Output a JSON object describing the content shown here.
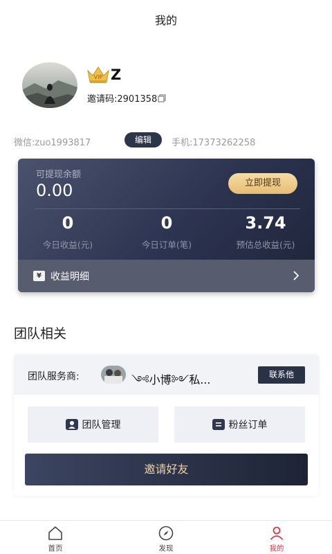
{
  "header": {
    "title": "我的"
  },
  "profile": {
    "nickname": "Z",
    "invite_code": "邀请码:2901358",
    "wechat": "微信:zuo1993817",
    "edit_label": "编辑",
    "phone": "手机:17373262258",
    "vip_badge": "VIP"
  },
  "earnings": {
    "balance_label": "可提现余额",
    "balance_value": "0.00",
    "withdraw_label": "立即提现",
    "stats": [
      {
        "value": "0",
        "label": "今日收益(元)"
      },
      {
        "value": "0",
        "label": "今日订单(笔)"
      },
      {
        "value": "3.74",
        "label": "预估总收益(元)"
      }
    ],
    "detail_label": "收益明细",
    "detail_icon": "¥"
  },
  "team": {
    "section_title": "团队相关",
    "provider_label": "团队服务商:",
    "provider_name": "༺小博༻私...",
    "contact_label": "联系他",
    "tiles": [
      {
        "label": "团队管理",
        "icon": "team-icon"
      },
      {
        "label": "粉丝订单",
        "icon": "list-icon"
      }
    ],
    "invite_label": "邀请好友"
  },
  "tabbar": {
    "items": [
      {
        "label": "首页",
        "icon": "home-icon"
      },
      {
        "label": "发现",
        "icon": "compass-icon"
      },
      {
        "label": "我的",
        "icon": "user-icon"
      }
    ],
    "active_color": "#e0364a"
  },
  "colors": {
    "card_dark": "#2c3350",
    "gold": "#e6bd74",
    "accent_red": "#e0364a"
  }
}
